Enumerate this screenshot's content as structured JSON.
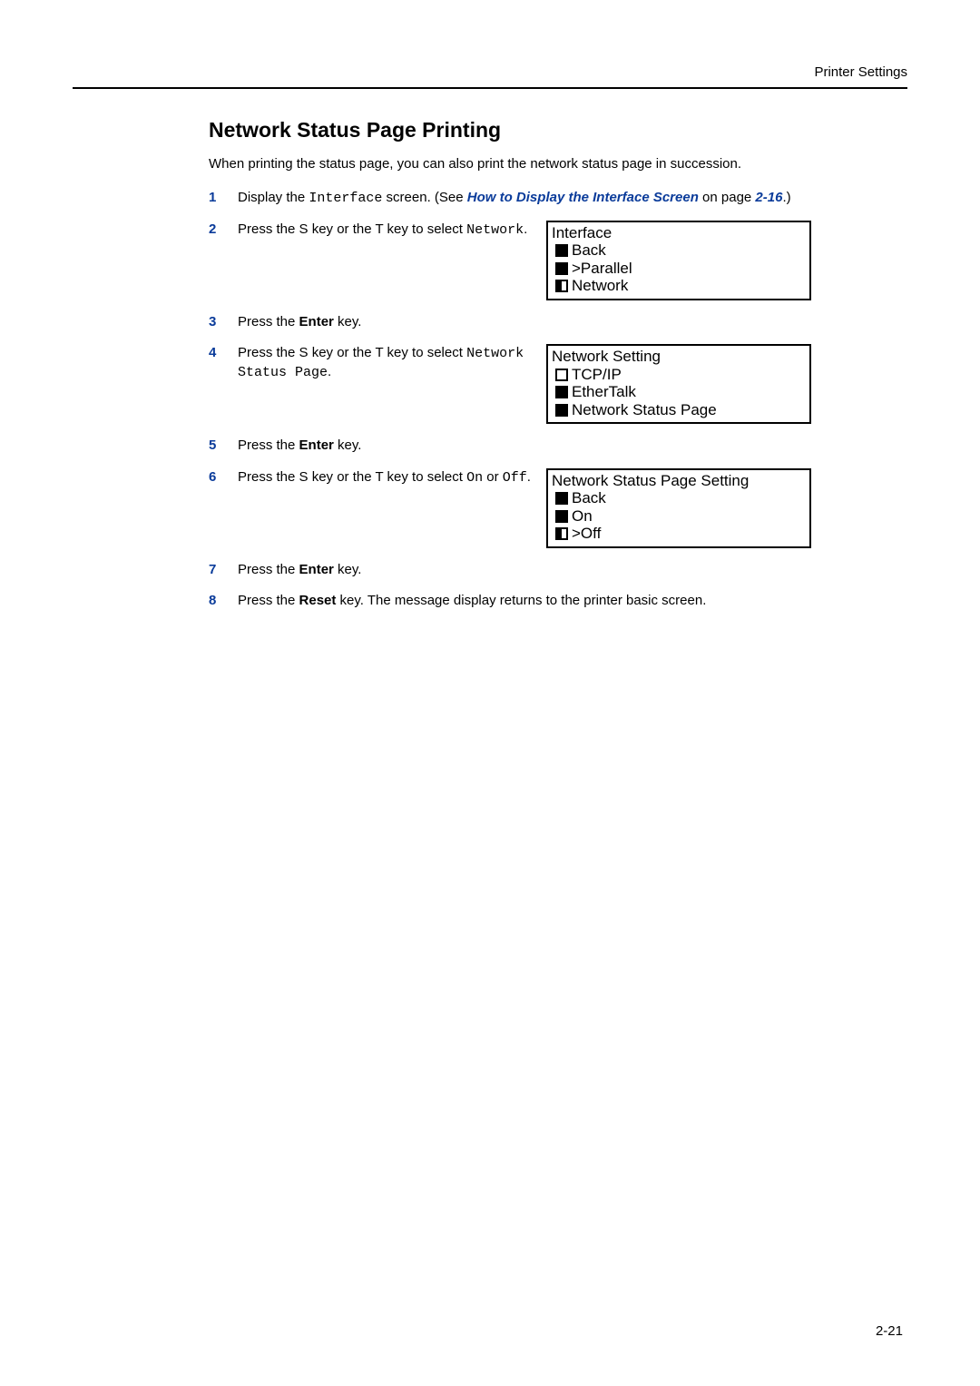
{
  "header": {
    "label": "Printer Settings"
  },
  "section": {
    "title": "Network Status Page Printing"
  },
  "intro": "When printing the status page, you can also print the network status page in succession.",
  "steps": {
    "s1": {
      "pre": "Display the ",
      "code": "Interface",
      "mid": " screen. (See ",
      "link": "How to Display the Interface Screen",
      "post1": " on page ",
      "pageref": "2-16",
      "post2": ".)"
    },
    "s2": {
      "pre": "Press the  S key or the  T key to select ",
      "code": "Network",
      "post": ".",
      "display": {
        "title": "Interface",
        "items": [
          "Back",
          ">Parallel",
          "Network"
        ]
      }
    },
    "s3": {
      "pre": "Press the ",
      "bold": "Enter",
      "post": " key."
    },
    "s4": {
      "pre": "Press the  S key or the  T key to select ",
      "code": "Network Status Page",
      "post": ".",
      "display": {
        "title": "Network Setting",
        "items": [
          "TCP/IP",
          "EtherTalk",
          "Network Status Page"
        ]
      }
    },
    "s5": {
      "pre": "Press the ",
      "bold": "Enter",
      "post": " key."
    },
    "s6": {
      "pre": "Press the  S key or the  T key to select ",
      "code1": "On",
      "mid": " or ",
      "code2": "Off",
      "post": ".",
      "display": {
        "title": "Network Status Page Setting",
        "items": [
          "Back",
          "On",
          ">Off"
        ]
      }
    },
    "s7": {
      "pre": "Press the ",
      "bold": "Enter",
      "post": " key."
    },
    "s8": {
      "pre": "Press the ",
      "bold": "Reset",
      "post": " key. The message display returns to the printer basic screen."
    }
  },
  "pagenum": "2-21"
}
